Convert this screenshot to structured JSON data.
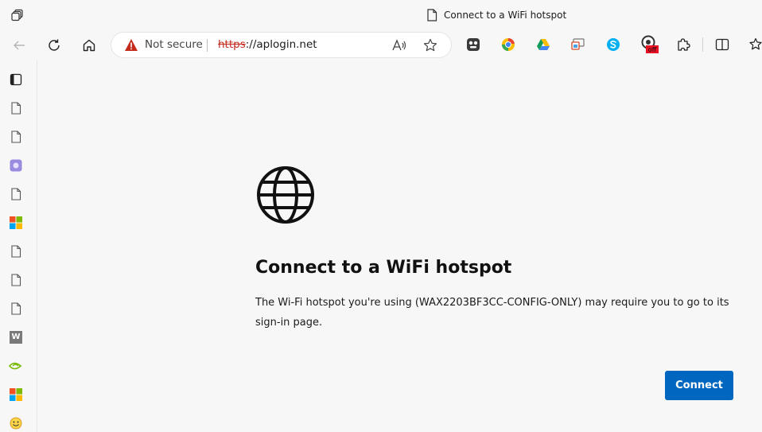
{
  "window": {
    "title": "Connect to a WiFi hotspot"
  },
  "addressbar": {
    "security_label": "Not secure",
    "url_scheme": "https",
    "url_rest": "://aplogin.net"
  },
  "extensions": [
    {
      "icon": "tampermonkey-icon"
    },
    {
      "icon": "chrome-like-icon"
    },
    {
      "icon": "google-drive-icon"
    },
    {
      "icon": "cast-icon"
    },
    {
      "icon": "skype-icon"
    },
    {
      "icon": "toggle-off-extension-icon",
      "badge": "off"
    },
    {
      "icon": "puzzle-extensions-icon"
    }
  ],
  "page": {
    "heading": "Connect to a WiFi hotspot",
    "description": "The Wi-Fi hotspot you're using (WAX2203BF3CC-CONFIG-ONLY) may require you to go to its sign-in page.",
    "connect_label": "Connect"
  },
  "colors": {
    "accent": "#0067c0",
    "warning": "#c42b1c",
    "background": "#f7f7f7"
  },
  "sidebar": {
    "items": [
      {
        "icon": "tab-sidebar-icon"
      },
      {
        "icon": "page-icon"
      },
      {
        "icon": "page-icon"
      },
      {
        "icon": "app-purple-icon"
      },
      {
        "icon": "page-icon"
      },
      {
        "icon": "microsoft-icon"
      },
      {
        "icon": "page-icon"
      },
      {
        "icon": "page-icon"
      },
      {
        "icon": "page-icon"
      },
      {
        "icon": "w-letter-icon",
        "label": "W"
      },
      {
        "icon": "nvidia-icon"
      },
      {
        "icon": "microsoft-icon"
      },
      {
        "icon": "emoji-app-icon"
      }
    ]
  }
}
